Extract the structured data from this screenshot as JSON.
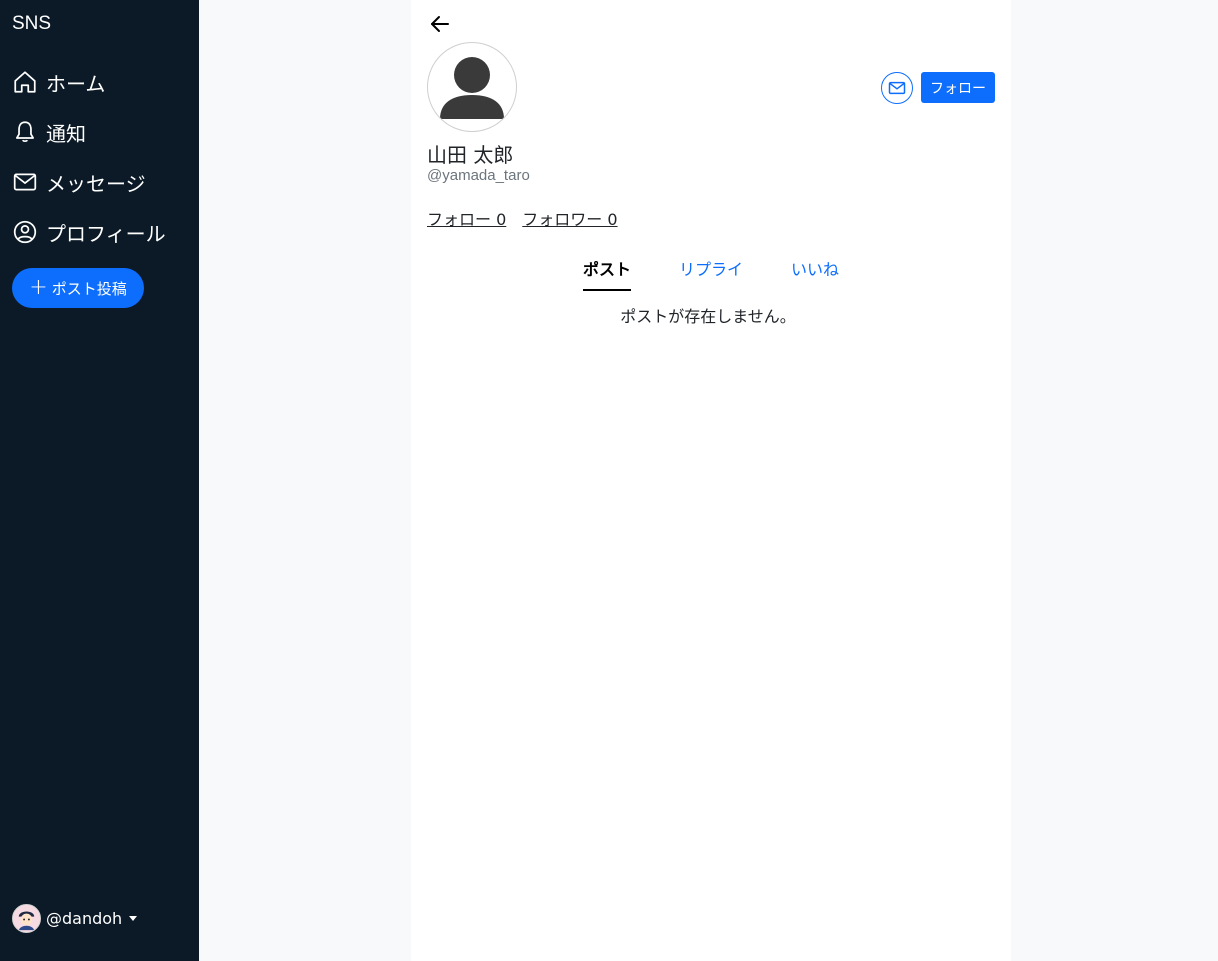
{
  "sidebar": {
    "brand": "SNS",
    "items": [
      {
        "label": "ホーム",
        "icon": "home-icon"
      },
      {
        "label": "通知",
        "icon": "bell-icon"
      },
      {
        "label": "メッセージ",
        "icon": "envelope-icon"
      },
      {
        "label": "プロフィール",
        "icon": "person-circle-icon"
      }
    ],
    "post_button": "ポスト投稿",
    "account_handle": "@dandoh"
  },
  "profile": {
    "name": "山田 太郎",
    "username": "@yamada_taro",
    "follow_button": "フォロー",
    "following_label": "フォロー 0",
    "followers_label": "フォロワー 0"
  },
  "tabs": [
    {
      "label": "ポスト",
      "active": true
    },
    {
      "label": "リプライ",
      "active": false
    },
    {
      "label": "いいね",
      "active": false
    }
  ],
  "empty_message": "ポストが存在しません。",
  "colors": {
    "sidebar_bg": "#0b1a26",
    "accent": "#0d6efd",
    "page_bg": "#f8f9fa"
  }
}
